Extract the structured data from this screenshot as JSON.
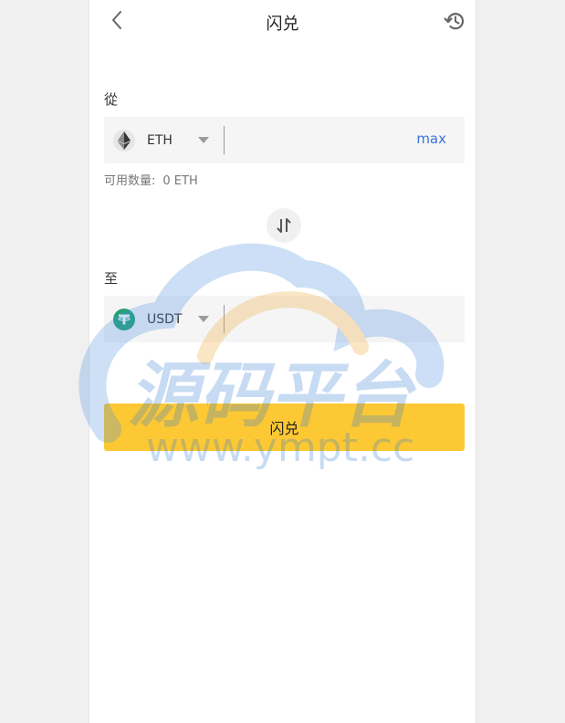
{
  "header": {
    "title": "闪兑",
    "back_icon": "chevron-left-icon",
    "history_icon": "history-icon"
  },
  "from": {
    "label": "從",
    "token": "ETH",
    "token_icon": "eth-icon",
    "amount_value": "",
    "max_label": "max"
  },
  "available": {
    "label": "可用数量:",
    "value": "0 ETH"
  },
  "swap_icon": "swap-vertical-icon",
  "to": {
    "label": "至",
    "token": "USDT",
    "token_icon": "usdt-icon",
    "amount_value": ""
  },
  "submit_label": "闪兑",
  "watermark": {
    "brand_text": "源码平台",
    "url_text": "www.ympt.cc"
  },
  "colors": {
    "accent": "#fcc833",
    "link": "#3b73d8",
    "usdt": "#26a17b",
    "background": "#f0f0f0"
  }
}
